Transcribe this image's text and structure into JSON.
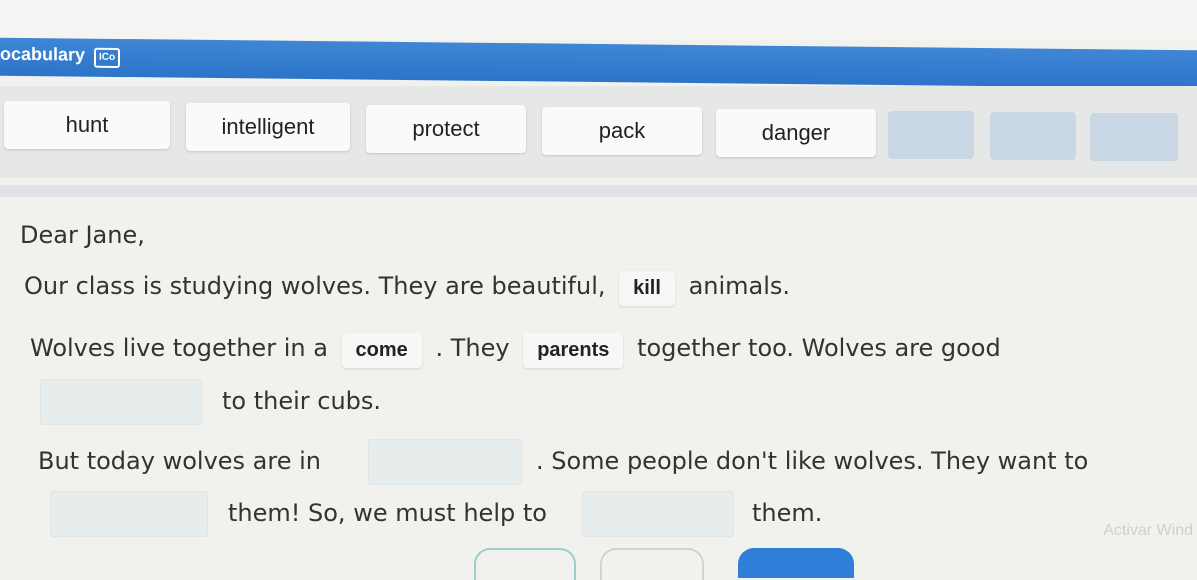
{
  "top": {
    "faded_text": ""
  },
  "vocab": {
    "title": "ocabulary",
    "badge": "ICo",
    "words": [
      "hunt",
      "intelligent",
      "protect",
      "pack",
      "danger"
    ]
  },
  "letter": {
    "greeting": "Dear Jane,",
    "line1_before": "Our class is studying wolves. They are beautiful,",
    "line1_fill": "kill",
    "line1_after": "animals.",
    "line2_before": "Wolves live together in a",
    "line2_fill1": "come",
    "line2_mid": ". They",
    "line2_fill2": "parents",
    "line2_after": "together too. Wolves are good",
    "line3_after": "to their cubs.",
    "line4_before": "But today wolves are in",
    "line4_after": ". Some people don't like wolves. They want to",
    "line5_mid": "them! So, we must help to",
    "line5_after": "them."
  },
  "watermark": "Activar Wind"
}
